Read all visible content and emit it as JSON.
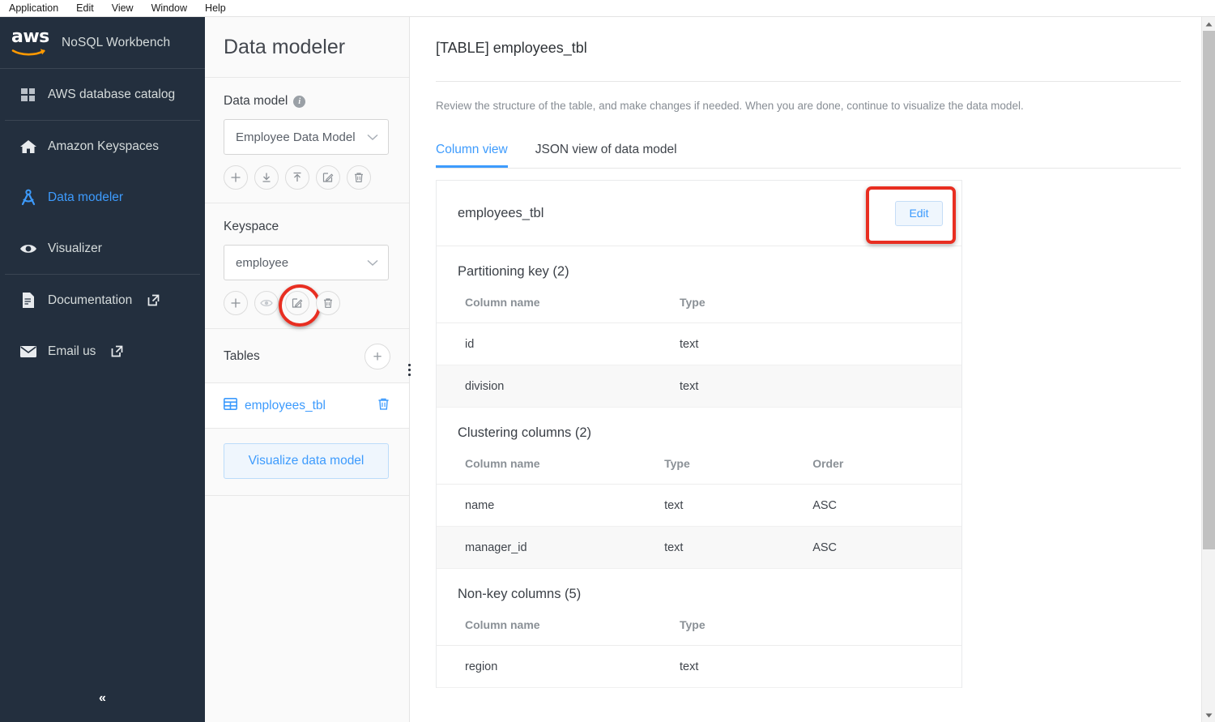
{
  "menubar": {
    "items": [
      "Application",
      "Edit",
      "View",
      "Window",
      "Help"
    ]
  },
  "brand": {
    "logo_text": "aws",
    "title": "NoSQL Workbench"
  },
  "sidebar": {
    "items": [
      {
        "label": "AWS database catalog",
        "icon": "grid-icon",
        "external": false,
        "active": false
      },
      {
        "label": "Amazon Keyspaces",
        "icon": "home-icon",
        "external": false,
        "active": false
      },
      {
        "label": "Data modeler",
        "icon": "compass-icon",
        "external": false,
        "active": true
      },
      {
        "label": "Visualizer",
        "icon": "eye-icon",
        "external": false,
        "active": false
      },
      {
        "label": "Documentation",
        "icon": "document-icon",
        "external": true,
        "active": false
      },
      {
        "label": "Email us",
        "icon": "envelope-icon",
        "external": true,
        "active": false
      }
    ],
    "collapse_label": "«"
  },
  "modeler": {
    "heading": "Data modeler",
    "data_model": {
      "label": "Data model",
      "selected": "Employee Data Model",
      "actions": [
        "add-icon",
        "download-icon",
        "upload-icon",
        "edit-icon",
        "delete-icon"
      ]
    },
    "keyspace": {
      "label": "Keyspace",
      "selected": "employee",
      "actions": [
        "add-icon",
        "view-icon",
        "edit-icon",
        "delete-icon"
      ],
      "highlighted_action_index": 2
    },
    "tables": {
      "label": "Tables",
      "add_label": "+",
      "items": [
        {
          "name": "employees_tbl"
        }
      ]
    },
    "visualize_label": "Visualize data model"
  },
  "main": {
    "title": "[TABLE] employees_tbl",
    "description": "Review the structure of the table, and make changes if needed. When you are done, continue to visualize the data model.",
    "tabs": [
      {
        "label": "Column view",
        "active": true
      },
      {
        "label": "JSON view of data model",
        "active": false
      }
    ],
    "card": {
      "title": "employees_tbl",
      "edit_label": "Edit",
      "groups": [
        {
          "title": "Partitioning key (2)",
          "headers": [
            "Column name",
            "Type"
          ],
          "rows": [
            {
              "name": "id",
              "type": "text"
            },
            {
              "name": "division",
              "type": "text"
            }
          ]
        },
        {
          "title": "Clustering columns (2)",
          "headers": [
            "Column name",
            "Type",
            "Order"
          ],
          "rows": [
            {
              "name": "name",
              "type": "text",
              "order": "ASC"
            },
            {
              "name": "manager_id",
              "type": "text",
              "order": "ASC"
            }
          ]
        },
        {
          "title": "Non-key columns (5)",
          "headers": [
            "Column name",
            "Type"
          ],
          "rows": [
            {
              "name": "region",
              "type": "text"
            }
          ]
        }
      ]
    }
  },
  "colors": {
    "nav_bg": "#232f3e",
    "accent_blue": "#3d9bfd",
    "highlight_red": "#e82e21",
    "aws_orange": "#ff9900"
  }
}
